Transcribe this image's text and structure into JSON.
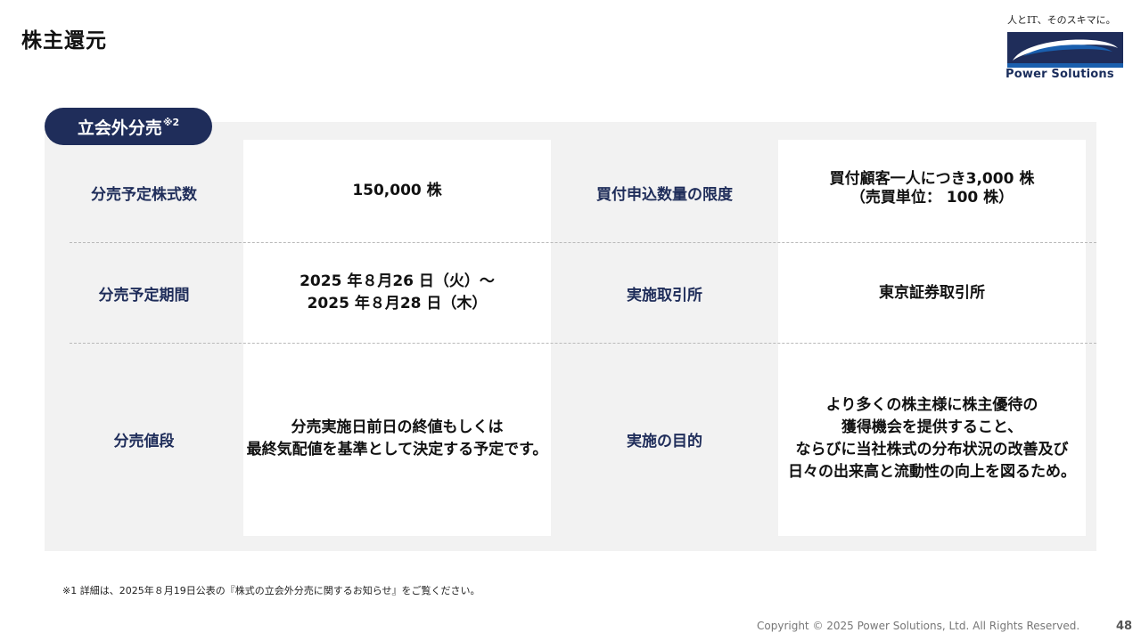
{
  "header": {
    "title": "株主還元",
    "logo": {
      "tagline": "人とIT、そのスキマに。",
      "name": "Power Solutions",
      "colors": {
        "navy": "#1f2d5a",
        "mark_blue": "#1a5fae"
      }
    }
  },
  "section": {
    "title": "立会外分売",
    "note_mark": "※2"
  },
  "table": {
    "rows": [
      {
        "left_label": "分売予定株式数",
        "left_value": [
          "150,000 株"
        ],
        "right_label": "買付申込数量の限度",
        "right_value": [
          "買付顧客一人につき3,000 株",
          "（売買単位： 100 株）"
        ]
      },
      {
        "left_label": "分売予定期間",
        "left_value": [
          "2025 年８月26 日（火）～",
          "2025 年８月28 日（木）"
        ],
        "right_label": "実施取引所",
        "right_value": [
          "東京証券取引所"
        ]
      },
      {
        "left_label": "分売値段",
        "left_value": [
          "分売実施日前日の終値もしくは",
          "最終気配値を基準として決定する予定です。"
        ],
        "right_label": "実施の目的",
        "right_value": [
          "より多くの株主様に株主優待の",
          "獲得機会を提供すること、",
          "ならびに当社株式の分布状況の改善及び",
          "日々の出来高と流動性の向上を図るため。"
        ]
      }
    ]
  },
  "footer": {
    "footnote": "※1 詳細は、2025年８月19日公表の『株式の立会外分売に関するお知らせ』をご覧ください。",
    "copyright": "Copyright © 2025 Power Solutions, Ltd. All Rights Reserved.",
    "page_number": "48"
  },
  "colors": {
    "accent_navy": "#1f2d5a",
    "panel_gray": "#f2f2f2",
    "divider": "#b9b9b9"
  }
}
